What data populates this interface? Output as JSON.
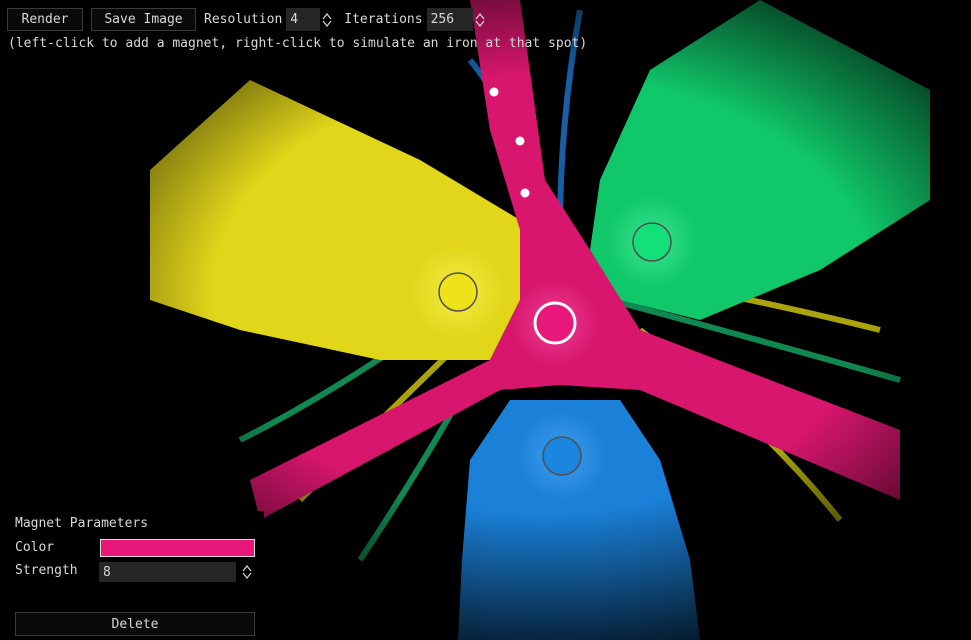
{
  "toolbar": {
    "render_label": "Render",
    "save_label": "Save Image",
    "resolution_label": "Resolution",
    "resolution_value": "4",
    "iterations_label": "Iterations",
    "iterations_value": "256"
  },
  "hint": "(left-click to add a magnet, right-click to simulate an iron at that spot)",
  "magnets": [
    {
      "color": "#e8177a",
      "selected": true
    },
    {
      "color": "#f0e21a",
      "selected": false
    },
    {
      "color": "#14e07a",
      "selected": false
    },
    {
      "color": "#1a86e0",
      "selected": false
    }
  ],
  "panel": {
    "title": "Magnet Parameters",
    "color_label": "Color",
    "color_value": "#e8177a",
    "strength_label": "Strength",
    "strength_value": "8",
    "delete_label": "Delete"
  }
}
